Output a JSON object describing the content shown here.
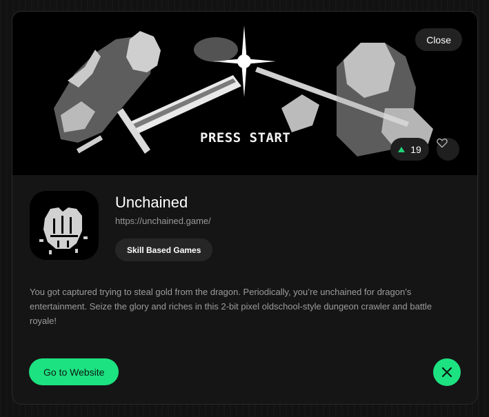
{
  "banner": {
    "text": "PRESS START",
    "close_label": "Close",
    "votes": "19"
  },
  "app": {
    "title": "Unchained",
    "url": "https://unchained.game/",
    "tag": "Skill Based Games",
    "description": "You got captured trying to steal gold from the dragon. Periodically, you’re unchained for dragon’s entertainment. Seize the glory and riches in this 2-bit pixel oldschool-style dungeon crawler and battle royale!"
  },
  "actions": {
    "website_label": "Go to Website",
    "social_icon": "x-icon"
  },
  "colors": {
    "accent": "#1de281",
    "upvote": "#22d37a",
    "background": "#151516"
  }
}
